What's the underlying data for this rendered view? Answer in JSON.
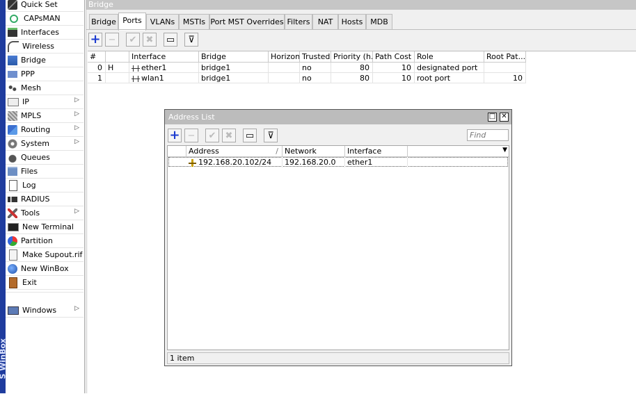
{
  "app": {
    "brand_text": "S WinBox"
  },
  "sidebar": {
    "items": [
      {
        "label": "Quick Set",
        "icon": "quick-set-icon",
        "submenu": false
      },
      {
        "label": "CAPsMAN",
        "icon": "capsman-icon",
        "submenu": false
      },
      {
        "label": "Interfaces",
        "icon": "interfaces-icon",
        "submenu": false
      },
      {
        "label": "Wireless",
        "icon": "wireless-icon",
        "submenu": false
      },
      {
        "label": "Bridge",
        "icon": "bridge-icon",
        "submenu": false
      },
      {
        "label": "PPP",
        "icon": "ppp-icon",
        "submenu": false
      },
      {
        "label": "Mesh",
        "icon": "mesh-icon",
        "submenu": false
      },
      {
        "label": "IP",
        "icon": "ip-icon",
        "submenu": true
      },
      {
        "label": "MPLS",
        "icon": "mpls-icon",
        "submenu": true
      },
      {
        "label": "Routing",
        "icon": "routing-icon",
        "submenu": true
      },
      {
        "label": "System",
        "icon": "system-icon",
        "submenu": true
      },
      {
        "label": "Queues",
        "icon": "queues-icon",
        "submenu": false
      },
      {
        "label": "Files",
        "icon": "files-icon",
        "submenu": false
      },
      {
        "label": "Log",
        "icon": "log-icon",
        "submenu": false
      },
      {
        "label": "RADIUS",
        "icon": "radius-icon",
        "submenu": false
      },
      {
        "label": "Tools",
        "icon": "tools-icon",
        "submenu": true
      },
      {
        "label": "New Terminal",
        "icon": "terminal-icon",
        "submenu": false
      },
      {
        "label": "Partition",
        "icon": "partition-icon",
        "submenu": false
      },
      {
        "label": "Make Supout.rif",
        "icon": "supout-icon",
        "submenu": false
      },
      {
        "label": "New WinBox",
        "icon": "new-winbox-icon",
        "submenu": false
      },
      {
        "label": "Exit",
        "icon": "exit-icon",
        "submenu": false
      }
    ],
    "windows": {
      "label": "Windows",
      "icon": "windows-icon",
      "submenu": true
    },
    "submenu_arrow": "▷"
  },
  "bridge_window": {
    "title": "Bridge",
    "tabs": [
      "Bridge",
      "Ports",
      "VLANs",
      "MSTIs",
      "Port MST Overrides",
      "Filters",
      "NAT",
      "Hosts",
      "MDB"
    ],
    "active_tab": "Ports",
    "toolbar": {
      "add": "+",
      "remove": "−",
      "enable": "✔",
      "disable": "✖",
      "comment": "▭",
      "filter": "⊽"
    },
    "columns": [
      "#",
      "",
      "Interface",
      "Bridge",
      "Horizon",
      "Trusted",
      "Priority (h...",
      "Path Cost",
      "Role",
      "Root Pat..."
    ],
    "rows": [
      {
        "num": "0",
        "flag": "H",
        "interface": "ether1",
        "bridge": "bridge1",
        "horizon": "",
        "trusted": "no",
        "priority": "80",
        "path_cost": "10",
        "role": "designated port",
        "root_path": ""
      },
      {
        "num": "1",
        "flag": "",
        "interface": "wlan1",
        "bridge": "bridge1",
        "horizon": "",
        "trusted": "no",
        "priority": "80",
        "path_cost": "10",
        "role": "root port",
        "root_path": "10"
      }
    ]
  },
  "address_list": {
    "title": "Address List",
    "restore_glyph": "□",
    "close_glyph": "✕",
    "find_placeholder": "Find",
    "columns": [
      "Address",
      "Network",
      "Interface"
    ],
    "sort_glyph": "/",
    "dropdown_glyph": "▼",
    "rows": [
      {
        "address": "192.168.20.102/24",
        "network": "192.168.20.0",
        "interface": "ether1"
      }
    ],
    "status": "1 item"
  }
}
